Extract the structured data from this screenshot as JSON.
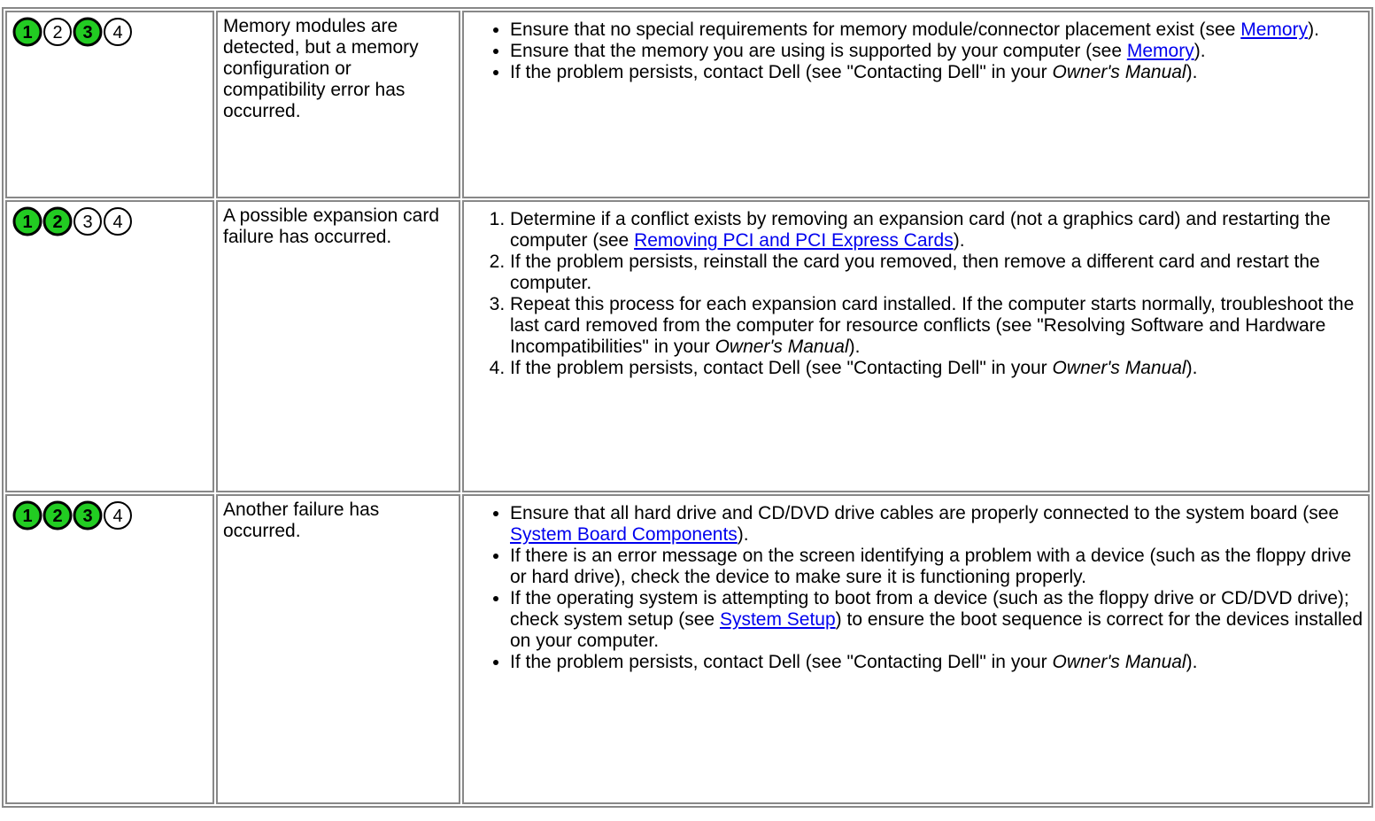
{
  "colors": {
    "led_on": "#22cc22",
    "led_off": "#ffffff",
    "link": "#0000ee",
    "border": "#888888"
  },
  "rows": [
    {
      "leds": [
        {
          "n": "1",
          "on": true
        },
        {
          "n": "2",
          "on": false
        },
        {
          "n": "3",
          "on": true
        },
        {
          "n": "4",
          "on": false
        }
      ],
      "desc": "Memory modules are detected, but a memory configuration or compatibility error has occurred.",
      "items": [
        {
          "pre": "Ensure that no special requirements for memory module/connector placement exist (see ",
          "link": "Memory",
          "post": ").",
          "em": "",
          "tail": ""
        },
        {
          "pre": "Ensure that the memory you are using is supported by your computer (see ",
          "link": "Memory",
          "post": ").",
          "em": "",
          "tail": ""
        },
        {
          "pre": "If the problem persists, contact Dell (see \"Contacting Dell\" in your ",
          "link": "",
          "post": "",
          "em": "Owner's Manual",
          "tail": ")."
        }
      ]
    },
    {
      "leds": [
        {
          "n": "1",
          "on": true
        },
        {
          "n": "2",
          "on": true
        },
        {
          "n": "3",
          "on": false
        },
        {
          "n": "4",
          "on": false
        }
      ],
      "desc": "A possible expansion card failure has occurred.",
      "items": [
        {
          "pre": "Determine if a conflict exists by removing an expansion card (not a graphics card) and restarting the computer (see ",
          "link": "Removing PCI and PCI Express Cards",
          "post": ").",
          "em": "",
          "tail": ""
        },
        {
          "pre": "If the problem persists, reinstall the card you removed, then remove a different card and restart the computer.",
          "link": "",
          "post": "",
          "em": "",
          "tail": ""
        },
        {
          "pre": "Repeat this process for each expansion card installed. If the computer starts normally, troubleshoot the last card removed from the computer for resource conflicts (see \"Resolving Software and Hardware Incompatibilities\" in your ",
          "link": "",
          "post": "",
          "em": "Owner's Manual",
          "tail": ")."
        },
        {
          "pre": "If the problem persists, contact Dell (see \"Contacting Dell\" in your ",
          "link": "",
          "post": "",
          "em": "Owner's Manual",
          "tail": ")."
        }
      ]
    },
    {
      "leds": [
        {
          "n": "1",
          "on": true
        },
        {
          "n": "2",
          "on": true
        },
        {
          "n": "3",
          "on": true
        },
        {
          "n": "4",
          "on": false
        }
      ],
      "desc": "Another failure has occurred.",
      "items": [
        {
          "pre": "Ensure that all hard drive and CD/DVD drive cables are properly connected to the system board (see ",
          "link": "System Board Components",
          "post": ").",
          "em": "",
          "tail": ""
        },
        {
          "pre": "If there is an error message on the screen identifying a problem with a device (such as the floppy drive or hard drive), check the device to make sure it is functioning properly.",
          "link": "",
          "post": "",
          "em": "",
          "tail": ""
        },
        {
          "pre": "If the operating system is attempting to boot from a device (such as the floppy drive or CD/DVD drive); check system setup (see ",
          "link": "System Setup",
          "post": ") to ensure the boot sequence is correct for the devices installed on your computer.",
          "em": "",
          "tail": ""
        },
        {
          "pre": "If the problem persists, contact Dell (see \"Contacting Dell\" in your ",
          "link": "",
          "post": "",
          "em": "Owner's Manual",
          "tail": ")."
        }
      ]
    }
  ]
}
